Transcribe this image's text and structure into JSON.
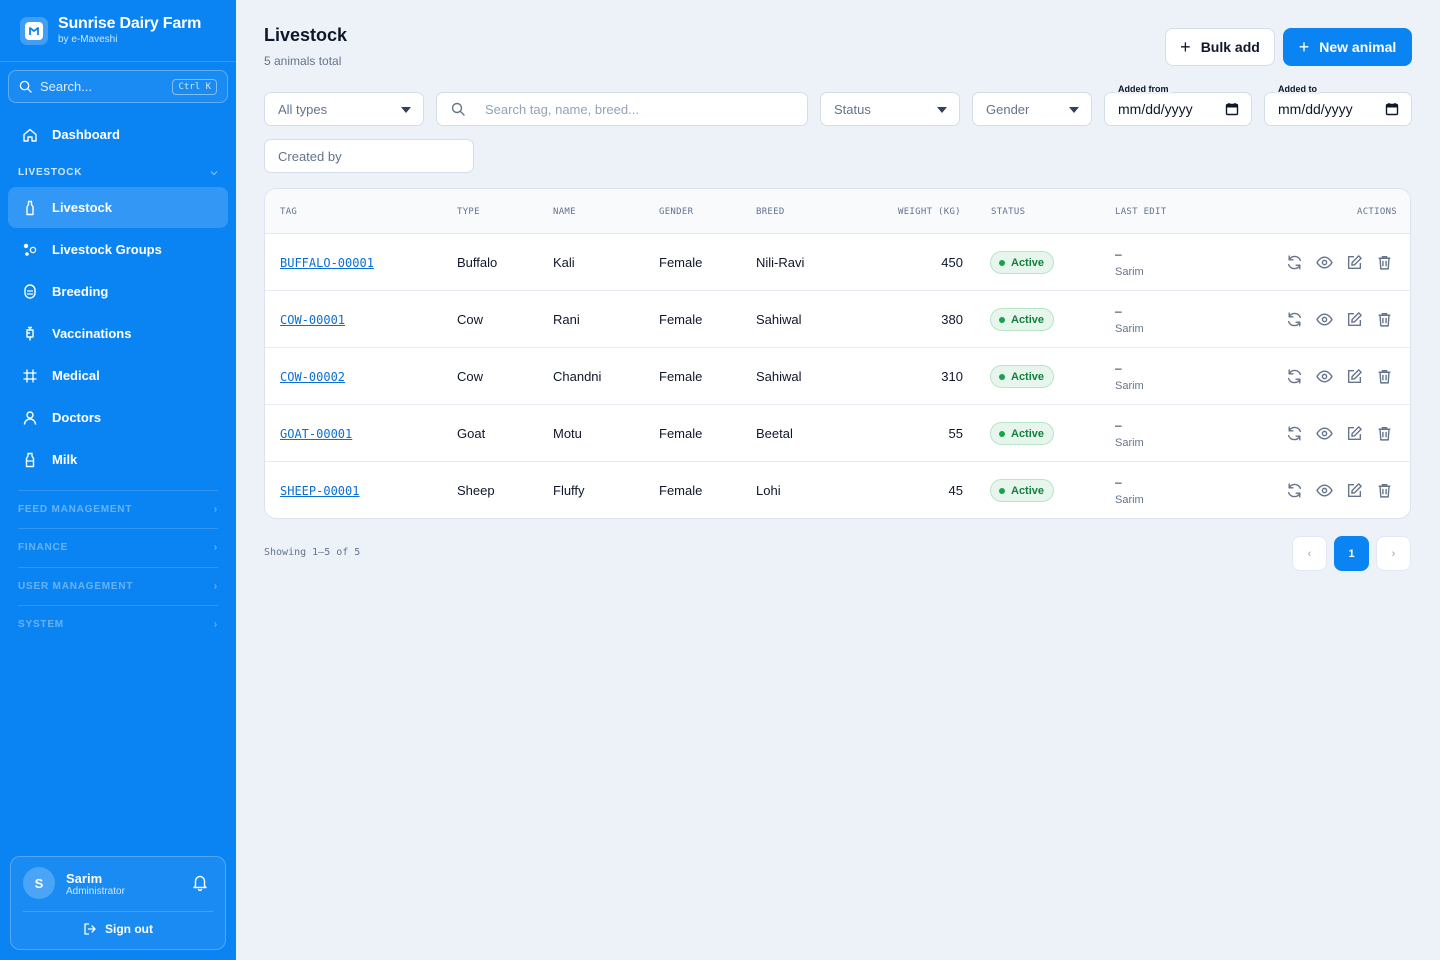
{
  "brand": {
    "title": "Sunrise Dairy Farm",
    "subtitle": "by e-Maveshi"
  },
  "search": {
    "placeholder": "Search...",
    "shortcut": "Ctrl K"
  },
  "nav": {
    "dashboard": "Dashboard",
    "livestock_section": "LIVESTOCK",
    "items": [
      {
        "label": "Livestock",
        "icon": "bottle-icon",
        "active": true
      },
      {
        "label": "Livestock Groups",
        "icon": "groups-icon",
        "active": false
      },
      {
        "label": "Breeding",
        "icon": "breeding-icon",
        "active": false
      },
      {
        "label": "Vaccinations",
        "icon": "syringe-icon",
        "active": false
      },
      {
        "label": "Medical",
        "icon": "medical-icon",
        "active": false
      },
      {
        "label": "Doctors",
        "icon": "user-icon",
        "active": false
      },
      {
        "label": "Milk",
        "icon": "milk-icon",
        "active": false
      }
    ],
    "sections": [
      "FEED MANAGEMENT",
      "FINANCE",
      "USER MANAGEMENT",
      "SYSTEM"
    ]
  },
  "user": {
    "initial": "S",
    "name": "Sarim",
    "role": "Administrator",
    "signout": "Sign out"
  },
  "header": {
    "title": "Livestock",
    "subtitle": "5 animals total",
    "bulk_add": "Bulk add",
    "new_animal": "New animal"
  },
  "filters": {
    "type": "All types",
    "search_placeholder": "Search tag, name, breed...",
    "status": "Status",
    "gender": "Gender",
    "added_from_label": "Added from",
    "added_from_value": "mm/dd/yyyy",
    "added_to_label": "Added to",
    "added_to_value": "mm/dd/yyyy",
    "created_by": "Created by"
  },
  "table": {
    "headers": [
      "TAG",
      "TYPE",
      "NAME",
      "GENDER",
      "BREED",
      "WEIGHT (KG)",
      "STATUS",
      "LAST EDIT",
      "ACTIONS"
    ],
    "rows": [
      {
        "tag": "BUFFALO-00001",
        "type": "Buffalo",
        "name": "Kali",
        "gender": "Female",
        "breed": "Nili-Ravi",
        "weight": "450",
        "status": "Active",
        "last_edit": "–",
        "edited_by": "Sarim"
      },
      {
        "tag": "COW-00001",
        "type": "Cow",
        "name": "Rani",
        "gender": "Female",
        "breed": "Sahiwal",
        "weight": "380",
        "status": "Active",
        "last_edit": "–",
        "edited_by": "Sarim"
      },
      {
        "tag": "COW-00002",
        "type": "Cow",
        "name": "Chandni",
        "gender": "Female",
        "breed": "Sahiwal",
        "weight": "310",
        "status": "Active",
        "last_edit": "–",
        "edited_by": "Sarim"
      },
      {
        "tag": "GOAT-00001",
        "type": "Goat",
        "name": "Motu",
        "gender": "Female",
        "breed": "Beetal",
        "weight": "55",
        "status": "Active",
        "last_edit": "–",
        "edited_by": "Sarim"
      },
      {
        "tag": "SHEEP-00001",
        "type": "Sheep",
        "name": "Fluffy",
        "gender": "Female",
        "breed": "Lohi",
        "weight": "45",
        "status": "Active",
        "last_edit": "–",
        "edited_by": "Sarim"
      }
    ],
    "action_icons": [
      "refresh-icon",
      "eye-icon",
      "edit-icon",
      "trash-icon"
    ]
  },
  "pagination": {
    "summary": "Showing 1–5 of 5",
    "prev": "‹",
    "current": "1",
    "next": "›"
  },
  "colors": {
    "primary": "#0b84f3",
    "background": "#edf2f8",
    "active_badge": "#15803d",
    "link": "#0b6fd3"
  }
}
